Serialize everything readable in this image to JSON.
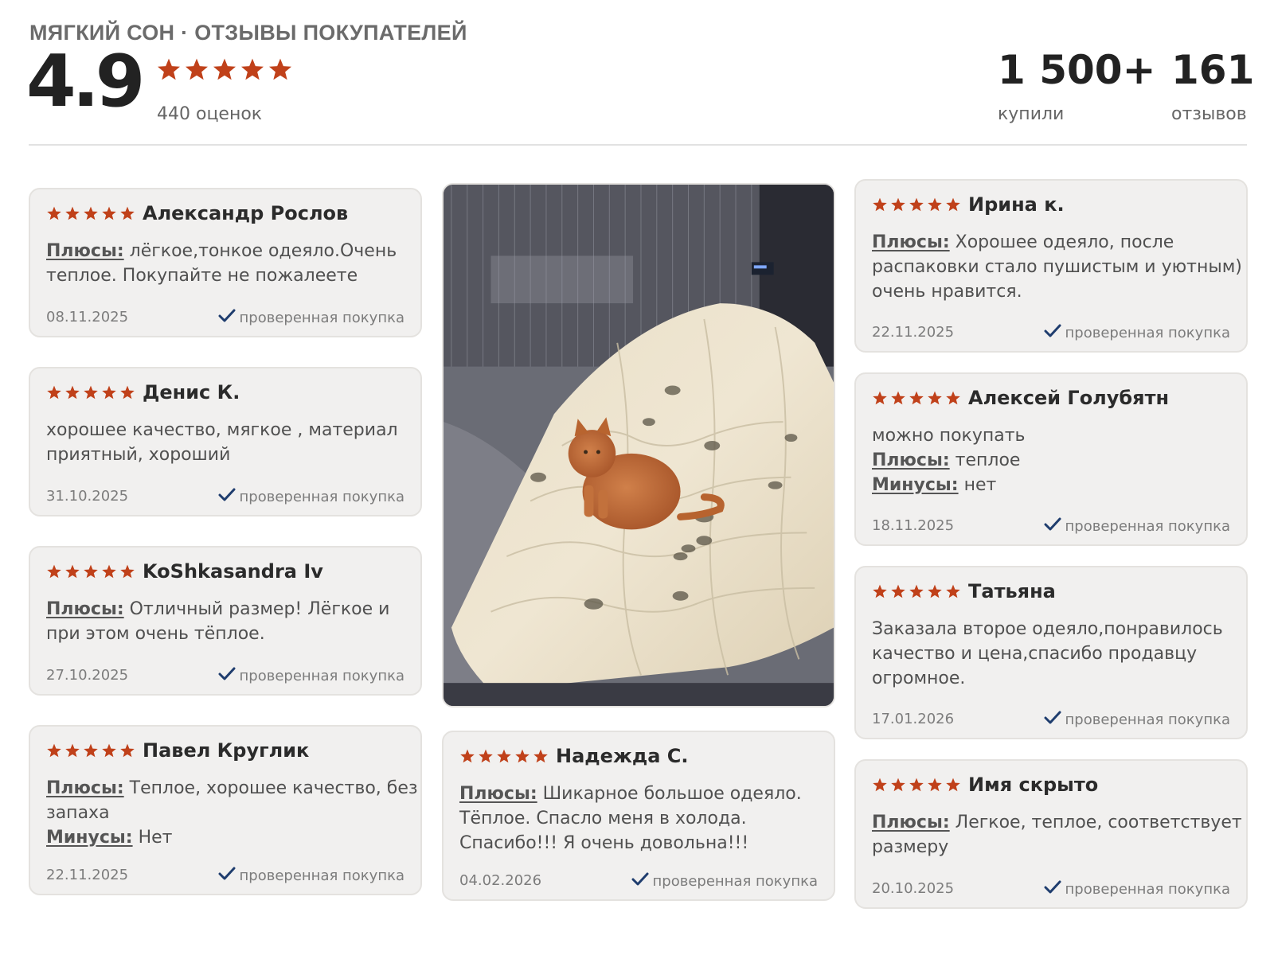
{
  "header": {
    "brand_title": "МЯГКИЙ СОН · ОТЗЫВЫ ПОКУПАТЕЛЕЙ",
    "rating": "4.9",
    "stars": 5,
    "ratings_count": "440 оценок",
    "stats": [
      {
        "value": "1 500+",
        "label": "купили"
      },
      {
        "value": "161",
        "label": "отзывов"
      }
    ]
  },
  "colors": {
    "star": "#c0411a",
    "card_bg": "#f1f0ef",
    "check": "#1f3d6e"
  },
  "verified_icon": "check-icon",
  "photo": {
    "description_icon": "review-photo"
  },
  "reviews": [
    {
      "name": "Александр Рослов",
      "stars": 5,
      "lines": [
        {
          "key": "Плюсы:",
          "text": " лёгкое,тонкое одеяло.Очень теплое. Покупайте не пожалеете"
        }
      ],
      "date": "08.11.2025",
      "verified": "проверенная покупка"
    },
    {
      "name": "Денис К.",
      "stars": 5,
      "lines": [
        {
          "key": "",
          "text": "хорошее качество, мягкое , материал приятный, хороший"
        }
      ],
      "date": "31.10.2025",
      "verified": "проверенная покупка"
    },
    {
      "name": "KoShkasandra Iv",
      "stars": 5,
      "lines": [
        {
          "key": "Плюсы:",
          "text": " Отличный размер! Лёгкое и при этом очень тёплое."
        }
      ],
      "date": "27.10.2025",
      "verified": "проверенная покупка"
    },
    {
      "name": "Павел Круглик",
      "stars": 5,
      "lines": [
        {
          "key": "Плюсы:",
          "text": " Теплое, хорошее качество, без запаха"
        },
        {
          "key": "Минусы:",
          "text": " Нет"
        }
      ],
      "date": "22.11.2025",
      "verified": "проверенная покупка"
    },
    {
      "name": "Надежда С.",
      "stars": 5,
      "lines": [
        {
          "key": "Плюсы:",
          "text": " Шикарное большое одеяло. Тёплое. Спасло меня в холода. Спасибо!!! Я очень довольна!!!"
        }
      ],
      "date": "04.02.2026",
      "verified": "проверенная покупка"
    },
    {
      "name": "Ирина к.",
      "stars": 5,
      "lines": [
        {
          "key": "Плюсы:",
          "text": " Хорошее одеяло, после распаковки стало пушистым и уютным) очень нравится."
        }
      ],
      "date": "22.11.2025",
      "verified": "проверенная покупка"
    },
    {
      "name": "Алексей Голубятн",
      "stars": 5,
      "lines": [
        {
          "key": "",
          "text": "можно покупать"
        },
        {
          "key": "Плюсы:",
          "text": " теплое"
        },
        {
          "key": "Минусы:",
          "text": " нет"
        }
      ],
      "date": "18.11.2025",
      "verified": "проверенная покупка"
    },
    {
      "name": "Татьяна",
      "stars": 5,
      "lines": [
        {
          "key": "",
          "text": "Заказала второе одеяло,понравилось качество и цена,спасибо продавцу огромное."
        }
      ],
      "date": "17.01.2026",
      "verified": "проверенная покупка"
    },
    {
      "name": "Имя скрыто",
      "stars": 5,
      "lines": [
        {
          "key": "Плюсы:",
          "text": " Легкое, теплое, соответствует размеру"
        }
      ],
      "date": "20.10.2025",
      "verified": "проверенная покупка"
    }
  ]
}
